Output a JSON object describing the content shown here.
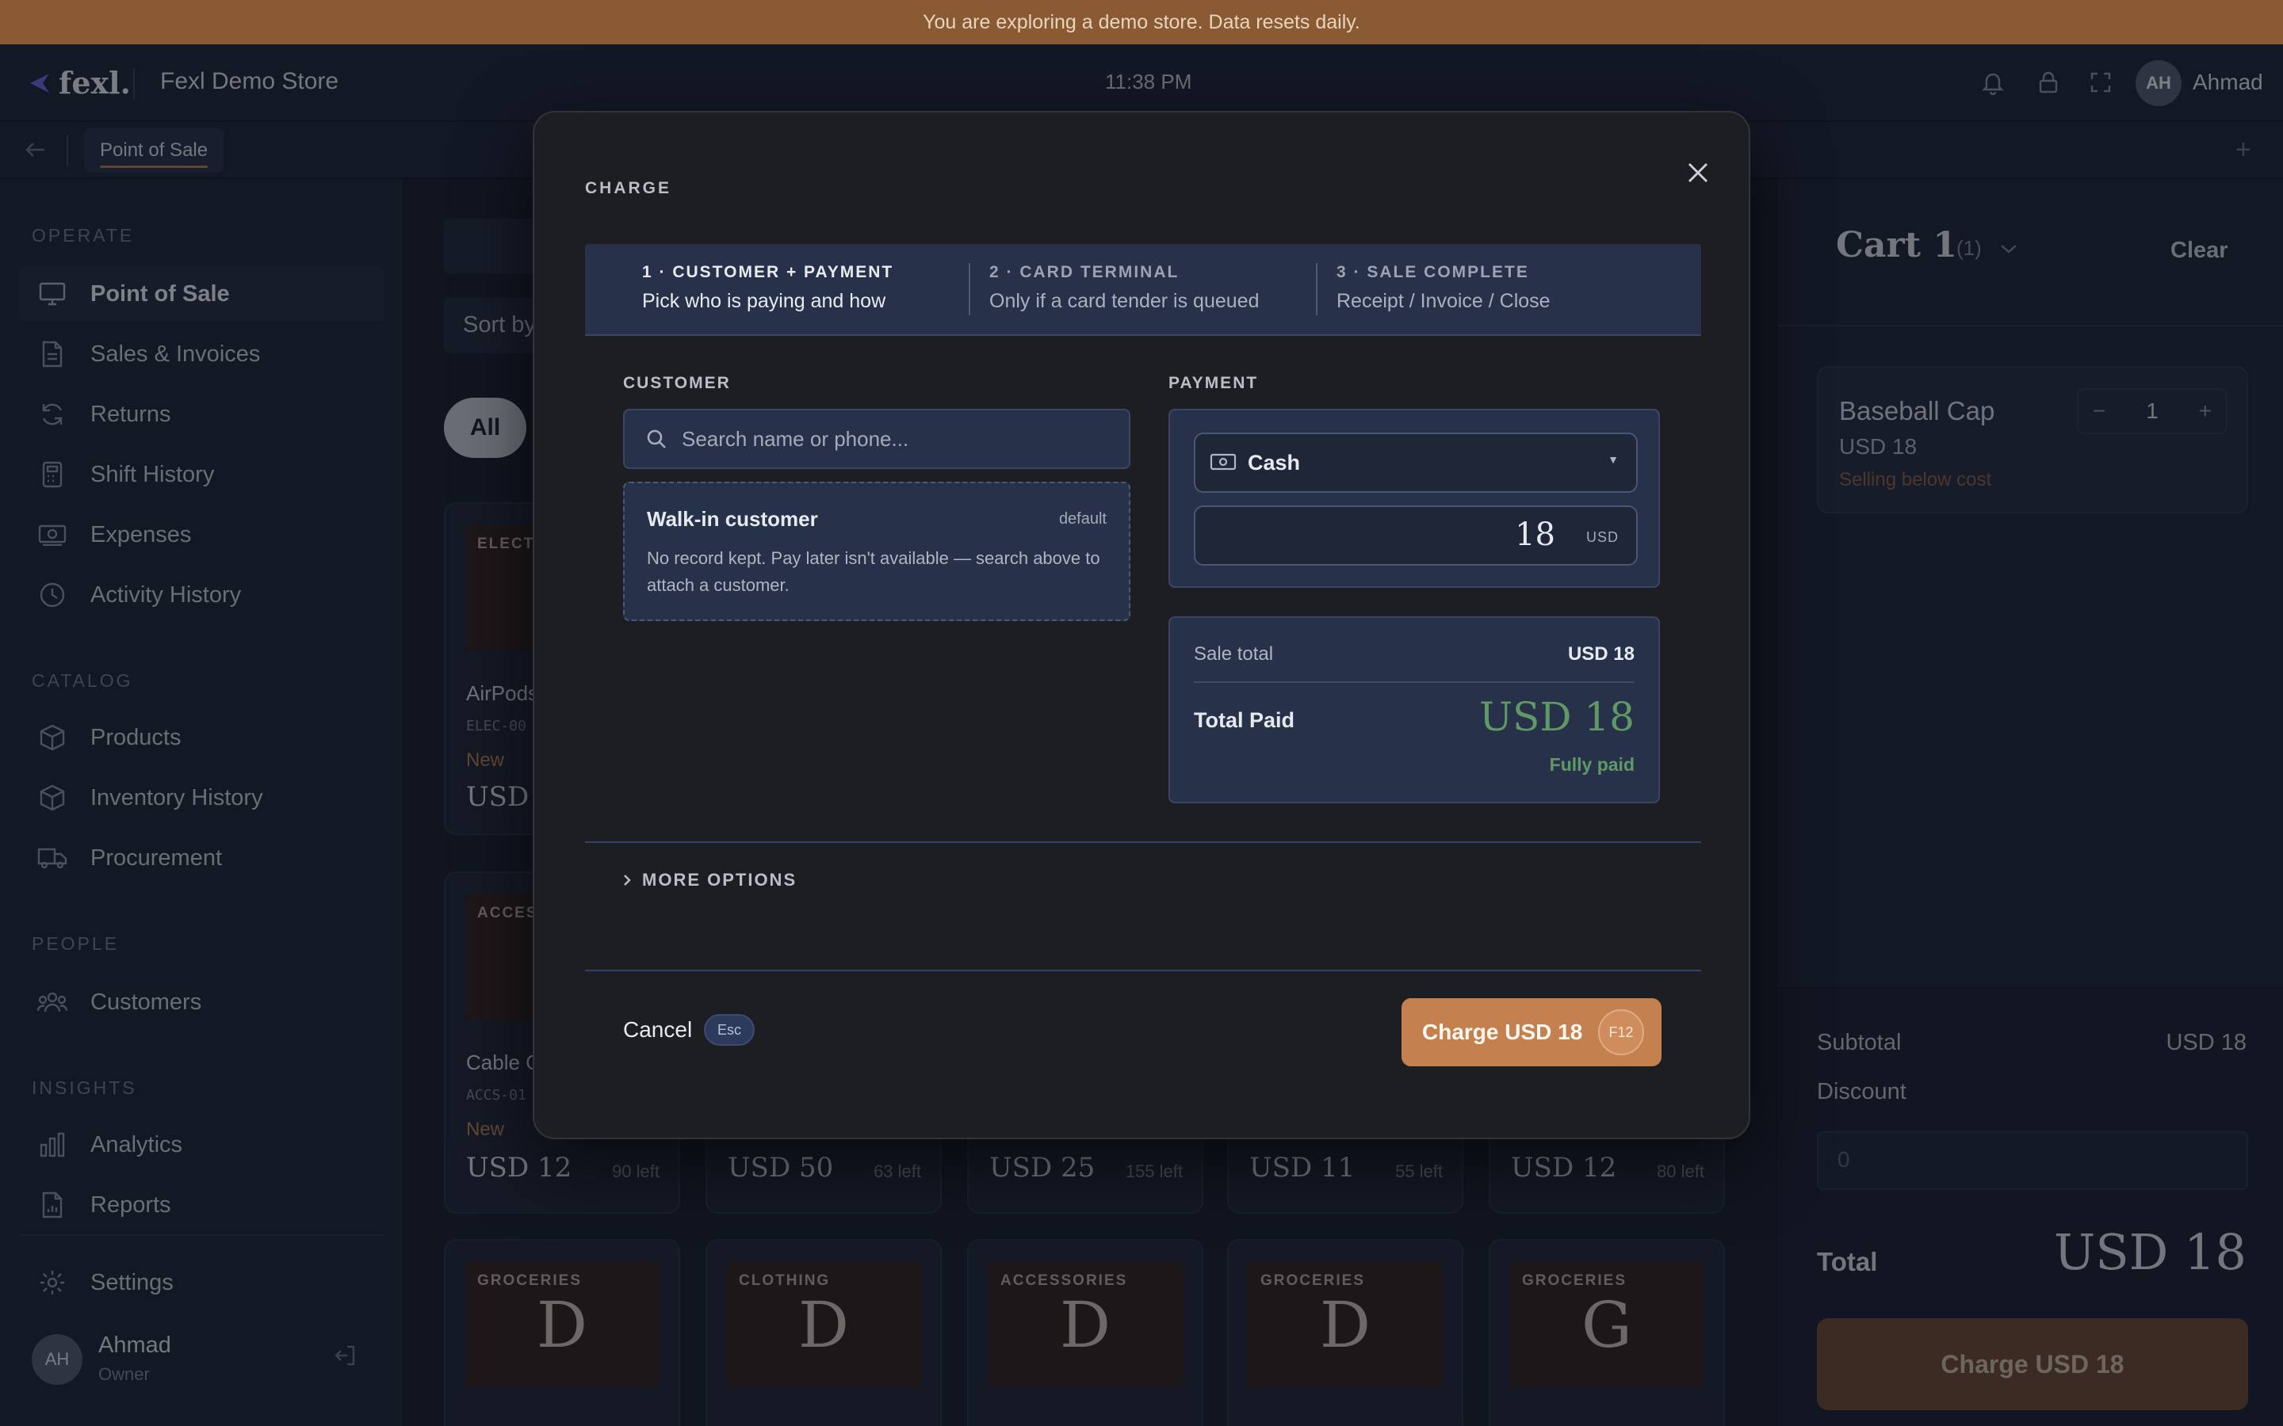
{
  "banner": {
    "text": "You are exploring a demo store. Data resets daily."
  },
  "topbar": {
    "logo": "fexl.",
    "store_name": "Fexl Demo Store",
    "time": "11:38 PM",
    "user_initials": "AH",
    "user_name": "Ahmad"
  },
  "tabs": {
    "active": "Point of Sale"
  },
  "sidebar": {
    "sections": {
      "operate": "OPERATE",
      "catalog": "CATALOG",
      "people": "PEOPLE",
      "insights": "INSIGHTS"
    },
    "items": [
      {
        "label": "Point of Sale",
        "icon": "monitor-icon"
      },
      {
        "label": "Sales & Invoices",
        "icon": "document-icon"
      },
      {
        "label": "Returns",
        "icon": "refresh-icon"
      },
      {
        "label": "Shift History",
        "icon": "calculator-icon"
      },
      {
        "label": "Expenses",
        "icon": "banknote-icon"
      },
      {
        "label": "Activity History",
        "icon": "clock-icon"
      },
      {
        "label": "Products",
        "icon": "box-icon"
      },
      {
        "label": "Inventory History",
        "icon": "box-icon"
      },
      {
        "label": "Procurement",
        "icon": "truck-icon"
      },
      {
        "label": "Customers",
        "icon": "users-icon"
      },
      {
        "label": "Analytics",
        "icon": "bar-chart-icon"
      },
      {
        "label": "Reports",
        "icon": "report-icon"
      },
      {
        "label": "Settings",
        "icon": "gear-icon"
      }
    ],
    "user": {
      "initials": "AH",
      "name": "Ahmad",
      "role": "Owner"
    }
  },
  "main": {
    "sort_label": "Sort by",
    "chip_all": "All",
    "products": [
      {
        "cat": "ELECT",
        "name": "AirPods",
        "sku": "ELEC-00",
        "new": "New",
        "price": "USD"
      },
      {
        "cat": "ACCES",
        "name": "Cable C",
        "sku": "ACCS-01",
        "new": "New",
        "price": "USD 12",
        "left": "90 left"
      },
      {
        "price": "USD 50",
        "left": "63 left"
      },
      {
        "price": "USD 25",
        "left": "155 left"
      },
      {
        "price": "USD 11",
        "left": "55 left"
      },
      {
        "price": "USD 12",
        "left": "80 left"
      },
      {
        "cat": "GROCERIES",
        "letter": "D"
      },
      {
        "cat": "CLOTHING",
        "letter": "D"
      },
      {
        "cat": "ACCESSORIES",
        "letter": "D"
      },
      {
        "cat": "GROCERIES",
        "letter": "D"
      },
      {
        "cat": "GROCERIES",
        "letter": "G"
      }
    ]
  },
  "cart": {
    "title": "Cart 1",
    "count": "(1)",
    "clear": "Clear",
    "item": {
      "name": "Baseball Cap",
      "price": "USD 18",
      "warning": "Selling below cost",
      "qty": "1"
    },
    "subtotal_label": "Subtotal",
    "subtotal": "USD 18",
    "discount_label": "Discount",
    "discount_placeholder": "0",
    "total_label": "Total",
    "total": "USD 18",
    "charge": "Charge USD 18"
  },
  "modal": {
    "title": "CHARGE",
    "steps": [
      {
        "title": "1 · CUSTOMER + PAYMENT",
        "desc": "Pick who is paying and how"
      },
      {
        "title": "2 · CARD TERMINAL",
        "desc": "Only if a card tender is queued"
      },
      {
        "title": "3 · SALE COMPLETE",
        "desc": "Receipt / Invoice / Close"
      }
    ],
    "customer_label": "CUSTOMER",
    "search_placeholder": "Search name or phone...",
    "walkin": {
      "name": "Walk-in customer",
      "badge": "default",
      "text": "No record kept. Pay later isn't available — search above to attach a customer."
    },
    "payment_label": "PAYMENT",
    "method": "Cash",
    "amount": "18",
    "currency": "USD",
    "sale_total_label": "Sale total",
    "sale_total": "USD 18",
    "total_paid_label": "Total Paid",
    "total_paid": "USD 18",
    "paid_status": "Fully paid",
    "more_options": "MORE OPTIONS",
    "cancel": "Cancel",
    "cancel_key": "Esc",
    "charge": "Charge USD 18",
    "charge_key": "F12"
  }
}
